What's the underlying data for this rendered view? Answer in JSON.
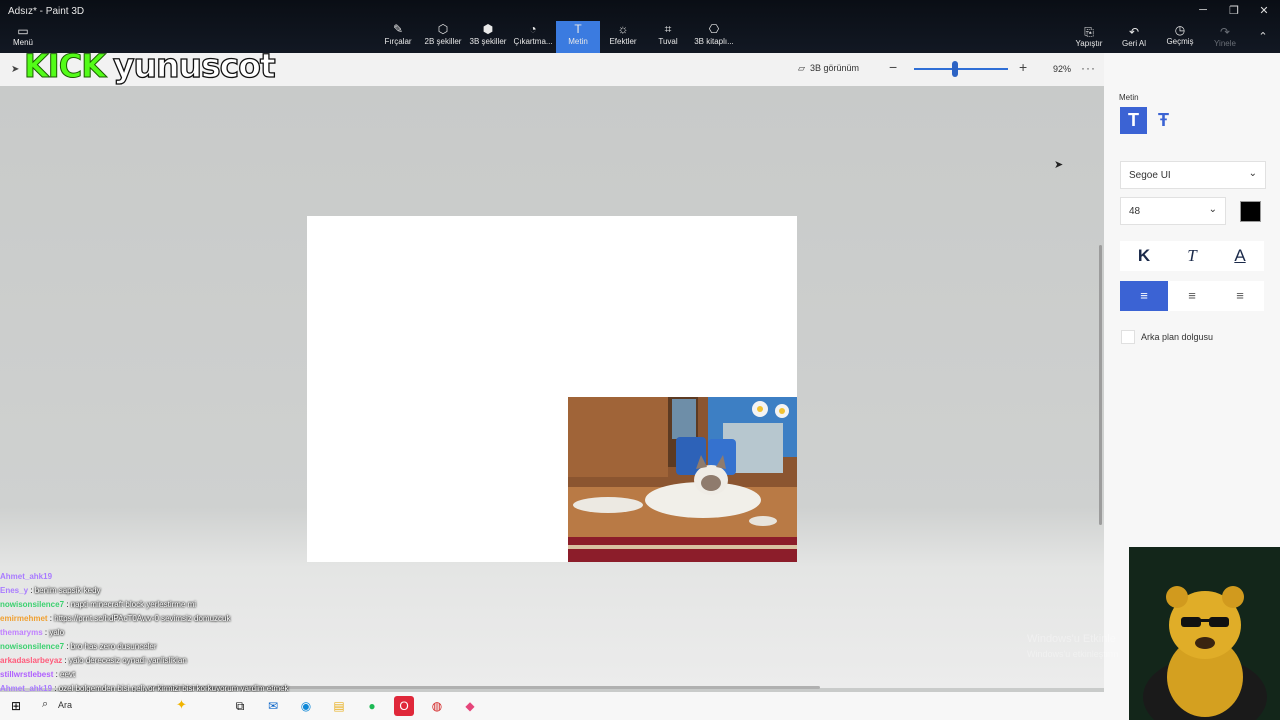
{
  "window": {
    "title": "Adsız* - Paint 3D"
  },
  "menu": {
    "label": "Menü"
  },
  "tools": [
    {
      "label": "Fırçalar",
      "icon": "brush-icon"
    },
    {
      "label": "2B şekiller",
      "icon": "2d-shapes-icon"
    },
    {
      "label": "3B şekiller",
      "icon": "3d-shapes-icon"
    },
    {
      "label": "Çıkartma...",
      "icon": "stickers-icon"
    },
    {
      "label": "Metin",
      "icon": "text-icon",
      "active": true
    },
    {
      "label": "Efektler",
      "icon": "effects-icon"
    },
    {
      "label": "Tuval",
      "icon": "canvas-icon"
    },
    {
      "label": "3B kitaplı...",
      "icon": "3d-library-icon"
    }
  ],
  "right_tools": {
    "paste": "Yapıştır",
    "undo": "Geri Al",
    "history": "Geçmiş",
    "redo": "Yinele"
  },
  "overlay": {
    "kick": "KICK",
    "channel": "yunuscot"
  },
  "view": {
    "view3d_label": "3B görünüm",
    "zoom_percent": 92,
    "zoom_label": "92%",
    "more": "···"
  },
  "text_panel": {
    "heading": "Metin",
    "font": "Segoe UI",
    "size": "48",
    "text_color": "#000000",
    "bold": "K",
    "italic": "T",
    "underline": "A",
    "align_left": "≡",
    "align_center": "≡",
    "align_right": "≡",
    "background_fill_label": "Arka plan dolgusu"
  },
  "chat": [
    {
      "user": "Ahmet_ahk19",
      "msg": ""
    },
    {
      "user": "Enes_y",
      "msg": "benim sapsik kedy"
    },
    {
      "user": "nowisonsilence7",
      "msg": "napti minecraft block yerlestirme mi"
    },
    {
      "user": "emirmehmet",
      "msg": "https://prnt.sc/hdPAcT0Awv-0 sevimsiz domuzcuk"
    },
    {
      "user": "themaryms",
      "msg": "yalo"
    },
    {
      "user": "nowisonsilence7",
      "msg": "bro has zero dusunceler"
    },
    {
      "user": "arkadaslarbeyaz",
      "msg": "yalo derecesiz oynadi yanlisliklan"
    },
    {
      "user": "stillwrstlebest",
      "msg": "eevt"
    },
    {
      "user": "Ahmet_ahk19",
      "msg": "ozel bolgemden bisi geliyor kirmizi bisi korkuyorum yardim etmek"
    }
  ],
  "taskbar": {
    "search_label": "Ara"
  },
  "watermark": {
    "line1": "Windows'u Etkinle",
    "line2": "Windows'u etkinleştirm"
  }
}
